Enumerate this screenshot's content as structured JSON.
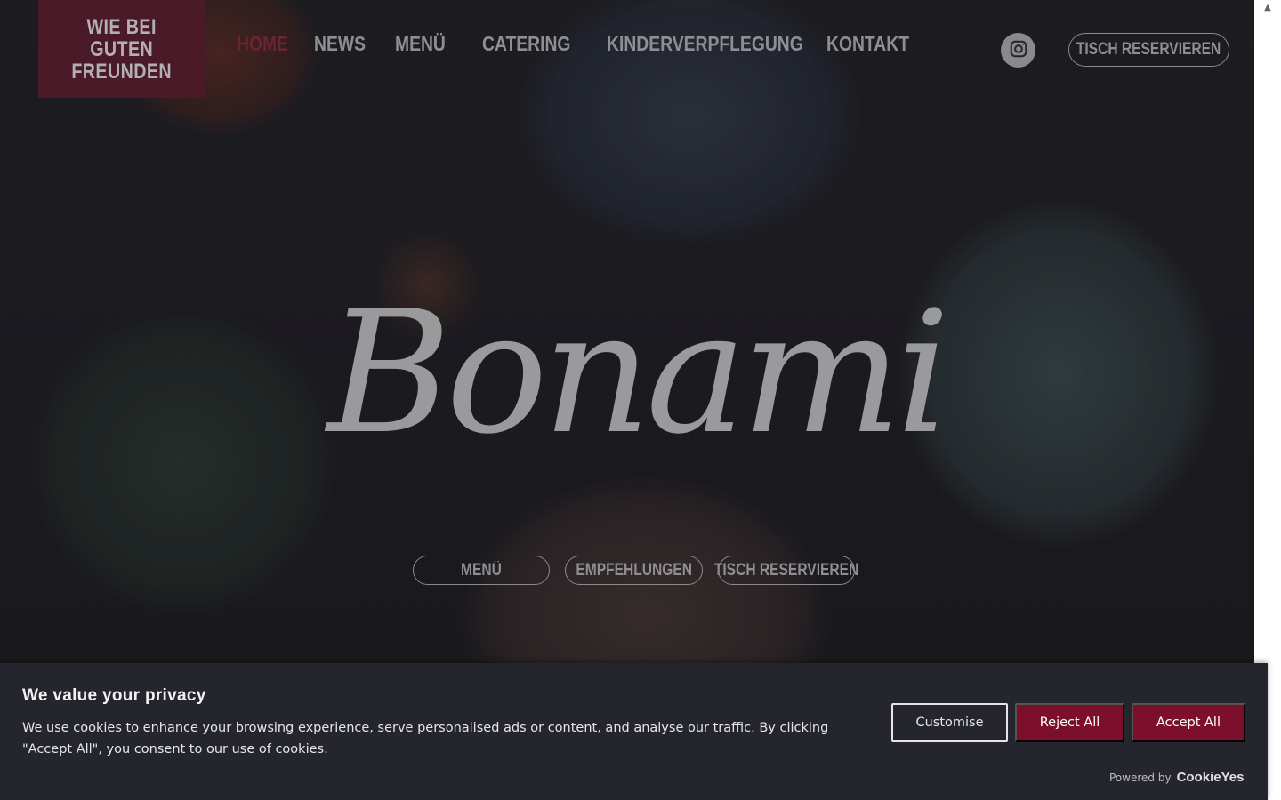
{
  "site": {
    "logo_text": "WIE BEI\nGUTEN\nFREUNDEN",
    "brand_script": "Bonami"
  },
  "nav": {
    "items": [
      {
        "label": "HOME",
        "active": true
      },
      {
        "label": "NEWS",
        "active": false
      },
      {
        "label": "MENÜ",
        "active": false
      },
      {
        "label": "CATERING",
        "active": false
      },
      {
        "label": "KINDERVERPFLEGUNG",
        "active": false
      },
      {
        "label": "KONTAKT",
        "active": false
      }
    ],
    "instagram_icon": "instagram-icon",
    "reserve_label": "TISCH RESERVIEREN"
  },
  "hero": {
    "buttons": [
      {
        "label": "MENÜ"
      },
      {
        "label": "EMPFEHLUNGEN"
      },
      {
        "label": "TISCH RESERVIEREN"
      }
    ]
  },
  "cookie_banner": {
    "title": "We value your privacy",
    "description": "We use cookies to enhance your browsing experience, serve personalised ads or content, and analyse our traffic. By clicking \"Accept All\", you consent to our use of cookies.",
    "customise_label": "Customise",
    "reject_label": "Reject All",
    "accept_label": "Accept All",
    "powered_by_label": "Powered by",
    "powered_by_brand": "CookieYes"
  },
  "colors": {
    "brand_burgundy": "#4b1a29",
    "nav_active": "#6a2434",
    "button_primary": "#7c0f2c",
    "nav_text": "#8f8f93",
    "banner_bg": "#25262d"
  }
}
